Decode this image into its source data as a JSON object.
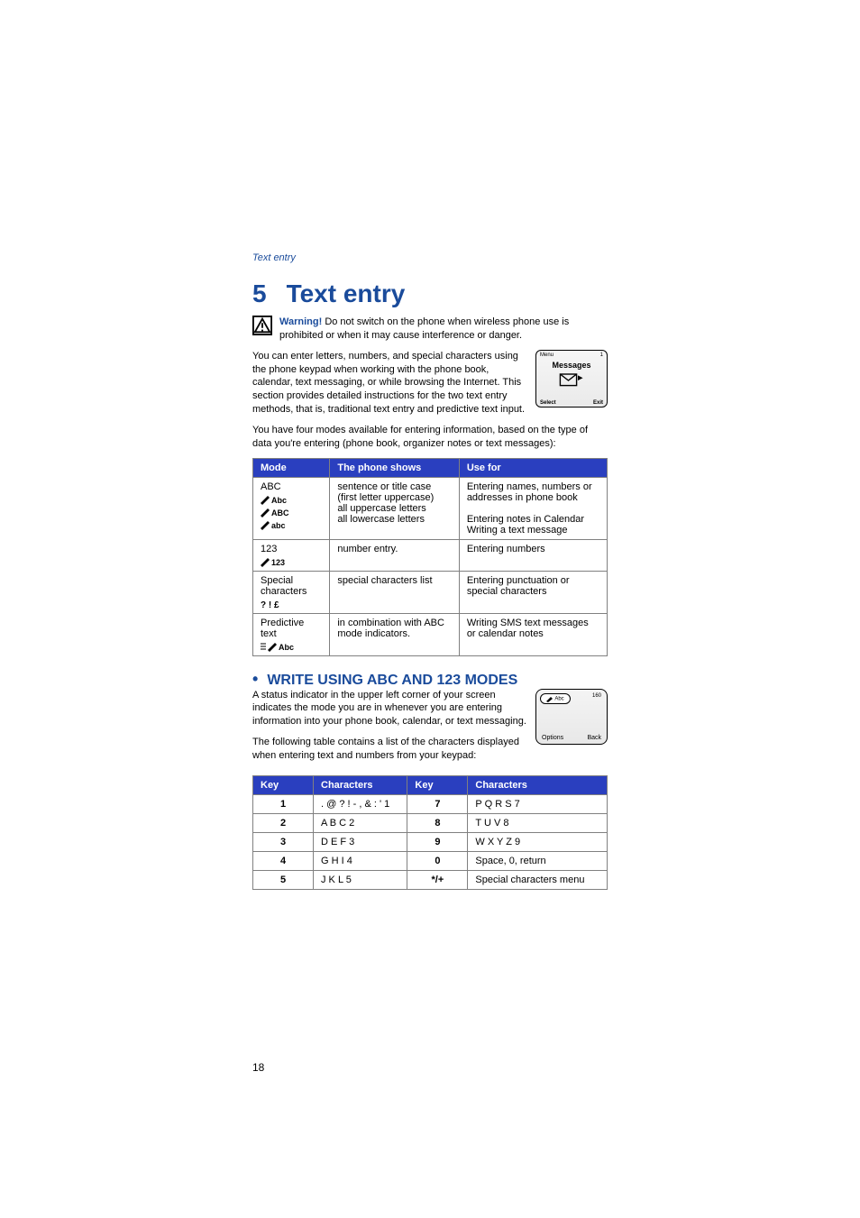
{
  "header_link": "Text entry",
  "chapter": {
    "num": "5",
    "title": "Text entry"
  },
  "warning": {
    "label": "Warning!",
    "text": "Do not switch on the phone when wireless phone use is prohibited or when it may cause interference or danger."
  },
  "phone1": {
    "top_left": "Menu",
    "top_right": "1",
    "title": "Messages",
    "bottom_left": "Select",
    "bottom_right": "Exit"
  },
  "intro": "You can enter letters, numbers, and special characters using the phone keypad when working with the phone book, calendar, text messaging, or while browsing the Internet. This section provides detailed instructions for the two text entry methods, that is, traditional text entry and predictive text input.",
  "intro2": "You have four modes available for entering information, based on the type of data you're entering (phone book, organizer notes or text messages):",
  "mode_table": {
    "headers": [
      "Mode",
      "The phone shows",
      "Use for"
    ],
    "rows": [
      {
        "mode_label": "ABC",
        "mode_indicators": [
          "Abc",
          "ABC",
          "abc"
        ],
        "shows": "sentence or title case (first letter uppercase)\nall uppercase letters\nall lowercase letters",
        "use": "Entering names, numbers or addresses in phone book\n\nEntering notes in Calendar\nWriting a text message"
      },
      {
        "mode_label": "123",
        "mode_indicators": [
          "123"
        ],
        "shows": "number entry.",
        "use": "Entering numbers"
      },
      {
        "mode_label": "Special characters",
        "mode_indicators": [
          "?!£"
        ],
        "shows": "special characters list",
        "use": "Entering punctuation or special characters"
      },
      {
        "mode_label": "Predictive text",
        "mode_indicators": [
          "Abc"
        ],
        "shows": "in combination with ABC mode indicators.",
        "use": "Writing SMS text messages or calendar notes"
      }
    ]
  },
  "section": {
    "title": "WRITE USING ABC AND 123 MODES"
  },
  "phone2": {
    "indicator": "Abc",
    "count": "160",
    "bottom_left": "Options",
    "bottom_right": "Back"
  },
  "section_p1": "A status indicator in the upper left corner of your screen indicates the mode you are in whenever you are entering information into your phone book, calendar, or text messaging.",
  "section_p2": "The following table contains a list of the characters displayed when entering text and numbers from your keypad:",
  "key_table": {
    "headers": [
      "Key",
      "Characters",
      "Key",
      "Characters"
    ],
    "rows": [
      {
        "k1": "1",
        "c1": ". @ ? ! - , & : ' 1",
        "k2": "7",
        "c2": "P Q R S 7"
      },
      {
        "k1": "2",
        "c1": "A B C 2",
        "k2": "8",
        "c2": "T U V 8"
      },
      {
        "k1": "3",
        "c1": "D E F 3",
        "k2": "9",
        "c2": "W X Y Z 9"
      },
      {
        "k1": "4",
        "c1": "G H I 4",
        "k2": "0",
        "c2": "Space, 0, return"
      },
      {
        "k1": "5",
        "c1": "J K L 5",
        "k2": "*/+",
        "c2": "Special characters menu"
      }
    ]
  },
  "page_number": "18",
  "chart_data": {
    "type": "table",
    "tables": [
      {
        "title": "Text entry modes",
        "columns": [
          "Mode",
          "The phone shows",
          "Use for"
        ],
        "rows": [
          [
            "ABC (Abc / ABC / abc)",
            "sentence or title case (first letter uppercase); all uppercase letters; all lowercase letters",
            "Entering names, numbers or addresses in phone book; Entering notes in Calendar; Writing a text message"
          ],
          [
            "123",
            "number entry.",
            "Entering numbers"
          ],
          [
            "Special characters (?!£)",
            "special characters list",
            "Entering punctuation or special characters"
          ],
          [
            "Predictive text (Abc)",
            "in combination with ABC mode indicators.",
            "Writing SMS text messages or calendar notes"
          ]
        ]
      },
      {
        "title": "Keypad character map",
        "columns": [
          "Key",
          "Characters"
        ],
        "rows": [
          [
            "1",
            ". @ ? ! - , & : ' 1"
          ],
          [
            "2",
            "A B C 2"
          ],
          [
            "3",
            "D E F 3"
          ],
          [
            "4",
            "G H I 4"
          ],
          [
            "5",
            "J K L 5"
          ],
          [
            "7",
            "P Q R S 7"
          ],
          [
            "8",
            "T U V 8"
          ],
          [
            "9",
            "W X Y Z 9"
          ],
          [
            "0",
            "Space, 0, return"
          ],
          [
            "*/+",
            "Special characters menu"
          ]
        ]
      }
    ]
  }
}
